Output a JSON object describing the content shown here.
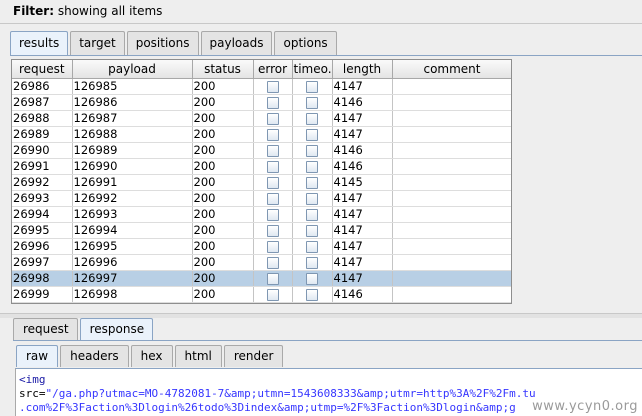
{
  "filter": {
    "label": "Filter:",
    "value": "showing all items"
  },
  "tabs": [
    {
      "label": "results",
      "active": true
    },
    {
      "label": "target",
      "active": false
    },
    {
      "label": "positions",
      "active": false
    },
    {
      "label": "payloads",
      "active": false
    },
    {
      "label": "options",
      "active": false
    }
  ],
  "table": {
    "headers": [
      "request",
      "payload",
      "status",
      "error",
      "timeo...",
      "length",
      "comment"
    ],
    "rows": [
      {
        "request": "26986",
        "payload": "126985",
        "status": "200",
        "length": "4147",
        "comment": "",
        "selected": false
      },
      {
        "request": "26987",
        "payload": "126986",
        "status": "200",
        "length": "4146",
        "comment": "",
        "selected": false
      },
      {
        "request": "26988",
        "payload": "126987",
        "status": "200",
        "length": "4147",
        "comment": "",
        "selected": false
      },
      {
        "request": "26989",
        "payload": "126988",
        "status": "200",
        "length": "4147",
        "comment": "",
        "selected": false
      },
      {
        "request": "26990",
        "payload": "126989",
        "status": "200",
        "length": "4146",
        "comment": "",
        "selected": false
      },
      {
        "request": "26991",
        "payload": "126990",
        "status": "200",
        "length": "4146",
        "comment": "",
        "selected": false
      },
      {
        "request": "26992",
        "payload": "126991",
        "status": "200",
        "length": "4145",
        "comment": "",
        "selected": false
      },
      {
        "request": "26993",
        "payload": "126992",
        "status": "200",
        "length": "4147",
        "comment": "",
        "selected": false
      },
      {
        "request": "26994",
        "payload": "126993",
        "status": "200",
        "length": "4147",
        "comment": "",
        "selected": false
      },
      {
        "request": "26995",
        "payload": "126994",
        "status": "200",
        "length": "4147",
        "comment": "",
        "selected": false
      },
      {
        "request": "26996",
        "payload": "126995",
        "status": "200",
        "length": "4147",
        "comment": "",
        "selected": false
      },
      {
        "request": "26997",
        "payload": "126996",
        "status": "200",
        "length": "4147",
        "comment": "",
        "selected": false
      },
      {
        "request": "26998",
        "payload": "126997",
        "status": "200",
        "length": "4147",
        "comment": "",
        "selected": true
      },
      {
        "request": "26999",
        "payload": "126998",
        "status": "200",
        "length": "4146",
        "comment": "",
        "selected": false
      }
    ]
  },
  "bottom_tabs": [
    {
      "label": "request",
      "active": false
    },
    {
      "label": "response",
      "active": true
    }
  ],
  "sub_tabs": [
    {
      "label": "raw",
      "active": true
    },
    {
      "label": "headers",
      "active": false
    },
    {
      "label": "hex",
      "active": false
    },
    {
      "label": "html",
      "active": false
    },
    {
      "label": "render",
      "active": false
    }
  ],
  "raw": {
    "line1_tag": "<img",
    "line2_attr": "src=",
    "line2_val": "\"/ga.php?utmac=MO-4782081-7&amp;utmn=1543608333&amp;utmr=http%3A%2F%2Fm.tu",
    "line3_val": ".com%2F%3Faction%3Dlogin%26todo%3Dindex&amp;utmp=%2F%3Faction%3Dlogin&amp;g"
  },
  "watermark": "www.ycyn0.org",
  "colors": {
    "selected_row": "#b8cfe5",
    "tab_active": "#eaf2fb",
    "tag": "#1a1aa6",
    "value": "#3636ff"
  }
}
